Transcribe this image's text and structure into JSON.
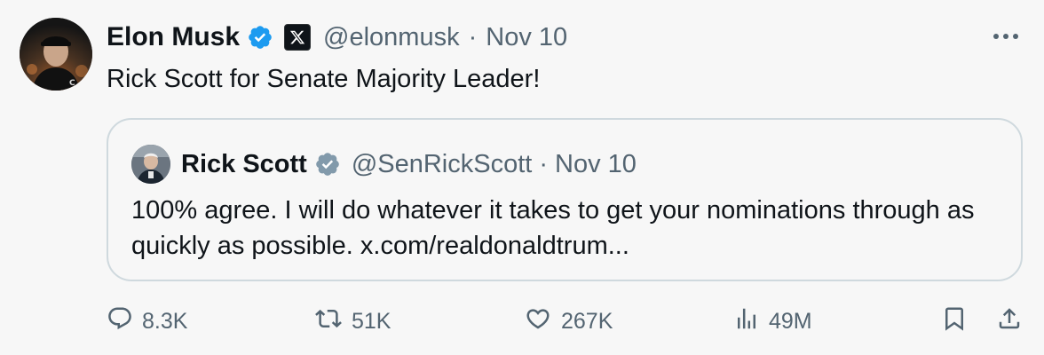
{
  "tweet": {
    "author_name": "Elon Musk",
    "handle": "@elonmusk",
    "separator": "·",
    "date": "Nov 10",
    "text": "Rick Scott for Senate Majority Leader!"
  },
  "quoted_tweet": {
    "author_name": "Rick Scott",
    "handle": "@SenRickScott",
    "separator": "·",
    "date": "Nov 10",
    "text": "100% agree. I will do whatever it takes to get your nominations through as quickly as possible. x.com/realdonaldtrum..."
  },
  "actions": {
    "replies": "8.3K",
    "reposts": "51K",
    "likes": "267K",
    "views": "49M"
  },
  "icons": {
    "verified_badge": "verified-blue-check-icon",
    "quoted_verified_badge": "verified-gray-check-icon",
    "affiliate_badge": "x-logo-icon",
    "more": "more-dots-icon",
    "reply": "reply-icon",
    "repost": "repost-icon",
    "like": "heart-icon",
    "views": "views-chart-icon",
    "bookmark": "bookmark-icon",
    "share": "share-icon"
  },
  "colors": {
    "background": "#f7f7f7",
    "text_primary": "#0f1419",
    "text_secondary": "#536471",
    "verified_blue": "#1d9bf0",
    "verified_gray": "#829aab",
    "border": "#cfd9de"
  }
}
